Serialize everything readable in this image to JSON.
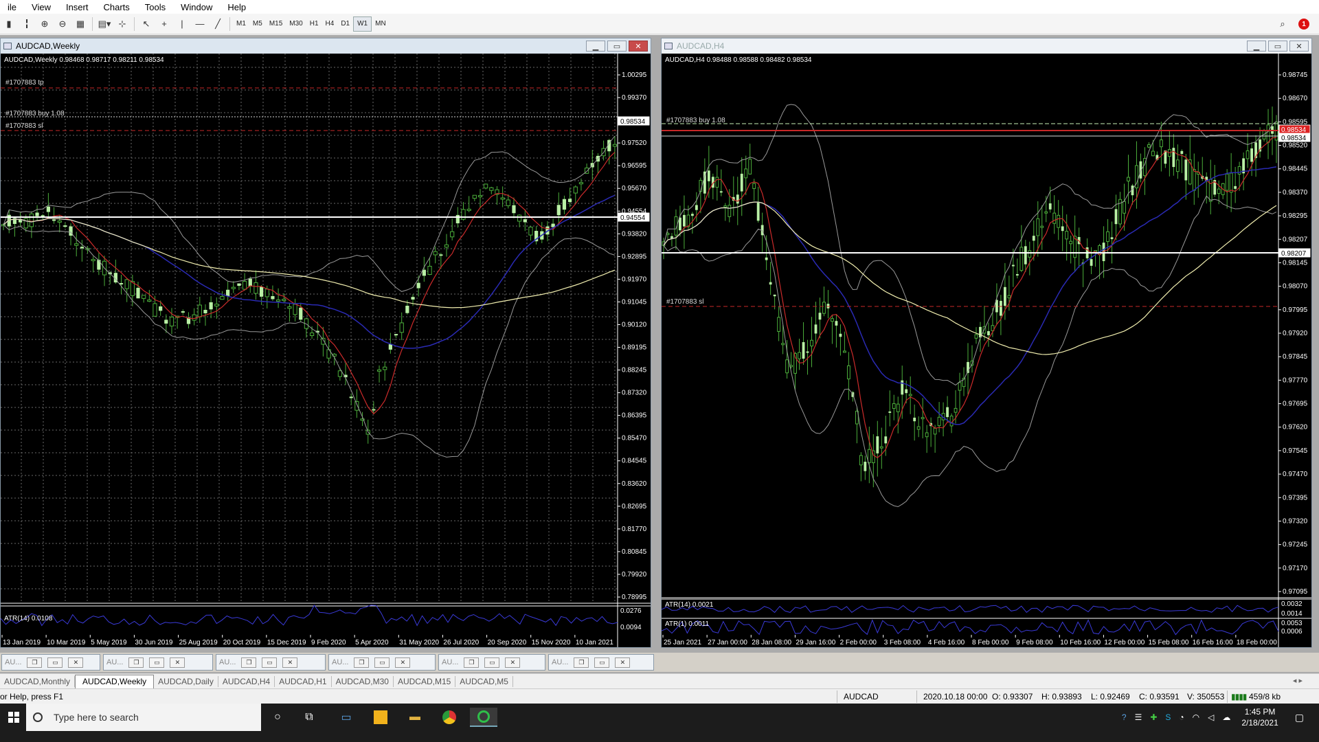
{
  "menu": [
    "ile",
    "View",
    "Insert",
    "Charts",
    "Tools",
    "Window",
    "Help"
  ],
  "toolbar": {
    "timeframes": [
      "M1",
      "M5",
      "M15",
      "M30",
      "H1",
      "H4",
      "D1",
      "W1",
      "MN"
    ],
    "active_timeframe": "W1",
    "notification_count": "1"
  },
  "window_left": {
    "title": "AUDCAD,Weekly",
    "info": "AUDCAD,Weekly  0.98468 0.98717 0.98211 0.98534",
    "tp_label": "#1707883 tp",
    "buy_label": "#1707883 buy 1.08",
    "sl_label": "#1707883 sl",
    "price_labels": [
      "1.00295",
      "0.99370",
      "0.98534",
      "0.97520",
      "0.96595",
      "0.95670",
      "0.94554",
      "0.93820",
      "0.92895",
      "0.91970",
      "0.91045",
      "0.90120",
      "0.89195",
      "0.88245",
      "0.87320",
      "0.86395",
      "0.85470",
      "0.84545",
      "0.83620",
      "0.82695",
      "0.81770",
      "0.80845",
      "0.79920",
      "0.78995"
    ],
    "current_price": "0.98534",
    "hline_price": "0.94554",
    "atr_label": "ATR(14) 0.0108",
    "atr_scale": [
      "0.0276",
      "0.0094"
    ],
    "time_labels": [
      "13 Jan 2019",
      "10 Mar 2019",
      "5 May 2019",
      "30 Jun 2019",
      "25 Aug 2019",
      "20 Oct 2019",
      "15 Dec 2019",
      "9 Feb 2020",
      "5 Apr 2020",
      "31 May 2020",
      "26 Jul 2020",
      "20 Sep 2020",
      "15 Nov 2020",
      "10 Jan 2021"
    ]
  },
  "window_right": {
    "title": "AUDCAD,H4",
    "info": "AUDCAD,H4  0.98488 0.98588 0.98482 0.98534",
    "buy_label": "#1707883 buy 1.08",
    "sl_label": "#1707883 sl",
    "price_labels": [
      "0.98745",
      "0.98670",
      "0.98595",
      "0.98520",
      "0.98445",
      "0.98370",
      "0.98295",
      "0.98207",
      "0.98145",
      "0.98070",
      "0.97995",
      "0.97920",
      "0.97845",
      "0.97770",
      "0.97695",
      "0.97620",
      "0.97545",
      "0.97470",
      "0.97395",
      "0.97320",
      "0.97245",
      "0.97170",
      "0.97095"
    ],
    "current_price": "0.98534",
    "hline_price": "0.98207",
    "atr14_label": "ATR(14) 0.0021",
    "atr14_scale": [
      "0.0032",
      "0.0014"
    ],
    "atr1_label": "ATR(1) 0.0011",
    "atr1_scale": [
      "0.0053",
      "0.0006"
    ],
    "time_labels": [
      "25 Jan 2021",
      "27 Jan 00:00",
      "28 Jan 08:00",
      "29 Jan 16:00",
      "2 Feb 00:00",
      "3 Feb 08:00",
      "4 Feb 16:00",
      "8 Feb 00:00",
      "9 Feb 08:00",
      "10 Feb 16:00",
      "12 Feb 00:00",
      "15 Feb 08:00",
      "16 Feb 16:00",
      "18 Feb 00:00"
    ]
  },
  "minimized": [
    "AU...",
    "AU...",
    "AU...",
    "AU...",
    "AU...",
    "AU..."
  ],
  "tabs": [
    "AUDCAD,Monthly",
    "AUDCAD,Weekly",
    "AUDCAD,Daily",
    "AUDCAD,H4",
    "AUDCAD,H1",
    "AUDCAD,M30",
    "AUDCAD,M15",
    "AUDCAD,M5"
  ],
  "active_tab": "AUDCAD,Weekly",
  "status": {
    "help": "or Help, press F1",
    "symbol": "AUDCAD",
    "datetime": "2020.10.18 00:00",
    "open": "O: 0.93307",
    "high": "H: 0.93893",
    "low": "L: 0.92469",
    "close": "C: 0.93591",
    "volume": "V: 350553",
    "traffic": "459/8 kb"
  },
  "taskbar": {
    "search_placeholder": "Type here to search",
    "time": "1:45 PM",
    "date": "2/18/2021"
  },
  "colors": {
    "chart_bg": "#000000",
    "bull_candle": "#b9f0a5",
    "wick": "#4caf3b",
    "ma_red": "#cc2b2b",
    "ma_blue": "#2a2ab4",
    "ma_yellow": "#f2efb0",
    "band": "#9a9a9a",
    "grid": "#6a6a6a",
    "sl_tp": "#c82828"
  }
}
